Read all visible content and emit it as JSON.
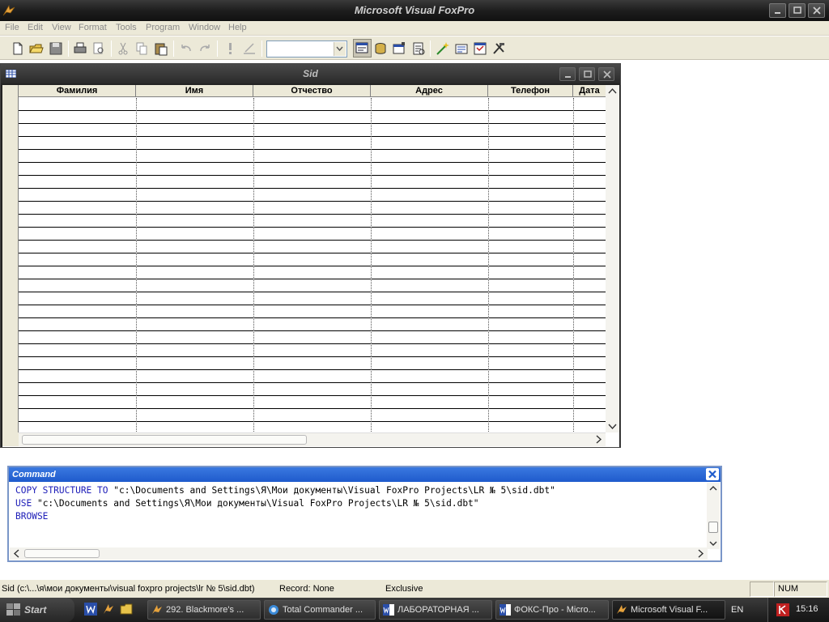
{
  "app": {
    "title": "Microsoft Visual FoxPro"
  },
  "menu": {
    "items": [
      "File",
      "Edit",
      "View",
      "Format",
      "Tools",
      "Program",
      "Window",
      "Help"
    ]
  },
  "toolbar": {
    "combo_value": ""
  },
  "browse": {
    "title": "Sid",
    "columns": [
      "Фамилия",
      "Имя",
      "Отчество",
      "Адрес",
      "Телефон",
      "Дата"
    ]
  },
  "command": {
    "title": "Command",
    "lines": [
      {
        "keyword": "COPY STRUCTURE TO",
        "rest": " \"c:\\Documents and Settings\\Я\\Мои документы\\Visual FoxPro Projects\\LR № 5\\sid.dbt\""
      },
      {
        "keyword": "USE",
        "rest": " \"c:\\Documents and Settings\\Я\\Мои документы\\Visual FoxPro Projects\\LR № 5\\sid.dbt\""
      },
      {
        "keyword": "BROWSE",
        "rest": ""
      }
    ]
  },
  "status": {
    "path": "Sid (c:\\...\\я\\мои документы\\visual foxpro projects\\lr № 5\\sid.dbt)",
    "record": "Record: None",
    "mode": "Exclusive",
    "num": "NUM"
  },
  "taskbar": {
    "start_label": "Start",
    "tasks": [
      "292. Blackmore's ...",
      "Total Commander ...",
      "ЛАБОРАТОРНАЯ ...",
      "ФОКС-Про - Micro...",
      "Microsoft Visual F..."
    ],
    "lang": "EN",
    "clock": "15:16"
  },
  "colors": {
    "command_keyword": "#1d1db8",
    "command_title": "#1f5bcc"
  }
}
